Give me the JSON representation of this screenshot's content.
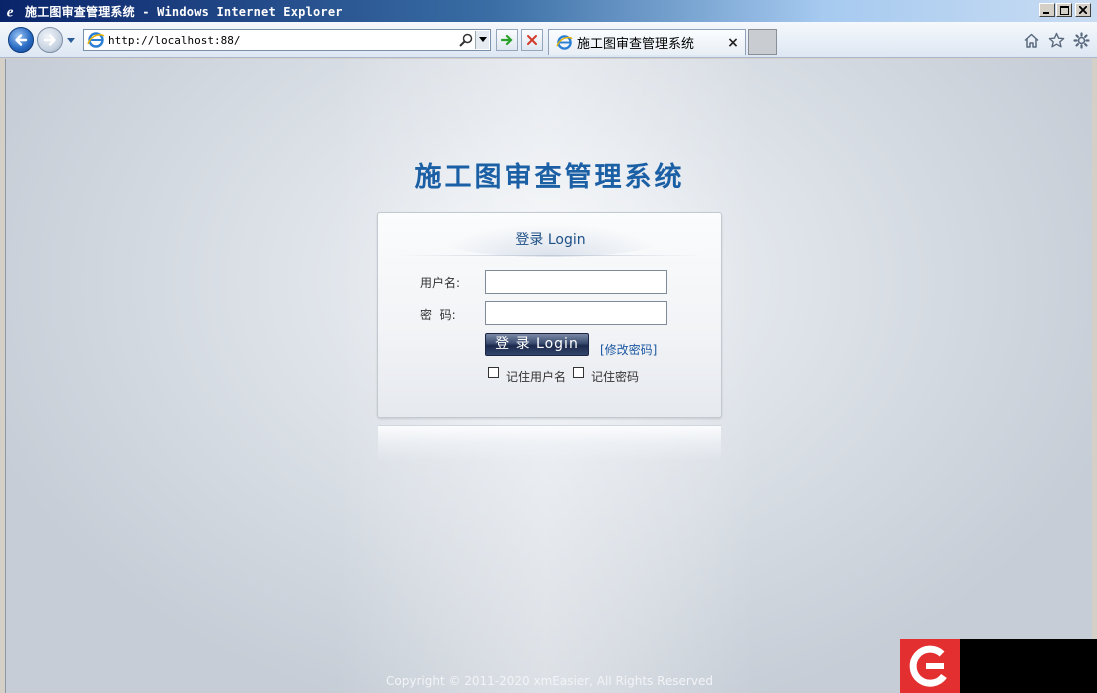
{
  "window": {
    "title": "施工图审查管理系统 - Windows Internet Explorer"
  },
  "browser": {
    "url": "http://localhost:88/",
    "tab_title": "施工图审查管理系统",
    "tab_close": "×"
  },
  "page": {
    "system_title": "施工图审查管理系统",
    "login_heading": "登录 Login",
    "username_label": "用户名:",
    "password_label": "密  码:",
    "username_value": "",
    "password_value": "",
    "login_button": "登 录 Login",
    "change_password_link": "[修改密码]",
    "remember_username": "记住用户名",
    "remember_password": "记住密码",
    "copyright": "Copyright © 2011-2020 xmEasier, All Rights Reserved"
  },
  "colors": {
    "title_blue": "#1b5fa5",
    "link_blue": "#1d58a3",
    "watermark_red": "#e32f2f"
  },
  "icons": [
    "ie-icon",
    "back-arrow-icon",
    "forward-arrow-icon",
    "search-icon",
    "go-arrow-icon",
    "stop-icon",
    "home-icon",
    "favorites-star-icon",
    "gear-icon"
  ]
}
